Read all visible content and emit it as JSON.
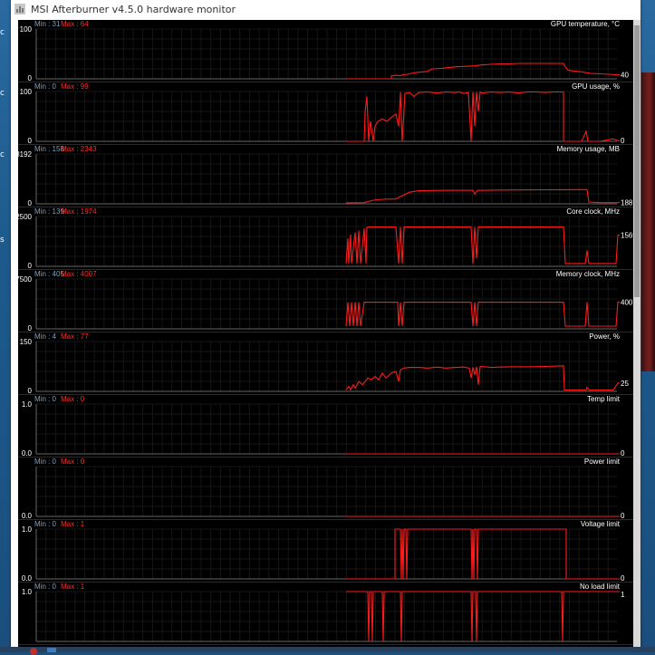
{
  "window": {
    "title": "MSI Afterburner v4.5.0 hardware monitor"
  },
  "desktop_glyphs": [
    "c",
    "c",
    "c",
    "s"
  ],
  "colors": {
    "graph_line": "#ff1a1a",
    "max_label": "#ff2a2a",
    "min_label": "#7aa0c0",
    "text": "#ffffff",
    "grid": "#161616",
    "separator": "#2a2a2a"
  },
  "graphs": [
    {
      "name": "GPU temperature, °C",
      "min_text": "Min : 31",
      "max_text": "Max : 64",
      "y_top_label": "100",
      "y_bottom_label": "0",
      "current_label": "40",
      "ymin": 0,
      "ymax": 100,
      "series": [
        [
          0,
          0
        ],
        [
          50,
          0
        ],
        [
          50,
          6
        ],
        [
          55,
          7
        ],
        [
          60,
          6
        ],
        [
          62,
          8
        ],
        [
          68,
          9
        ],
        [
          72,
          11
        ],
        [
          78,
          13
        ],
        [
          85,
          14
        ],
        [
          90,
          15
        ],
        [
          95,
          20
        ],
        [
          105,
          21
        ],
        [
          110,
          22
        ],
        [
          120,
          24
        ],
        [
          130,
          25
        ],
        [
          142,
          26
        ],
        [
          150,
          28
        ],
        [
          160,
          29
        ],
        [
          170,
          30
        ],
        [
          180,
          30
        ],
        [
          190,
          31
        ],
        [
          200,
          31
        ],
        [
          210,
          31
        ],
        [
          220,
          31
        ],
        [
          230,
          31
        ],
        [
          240,
          31
        ],
        [
          242,
          24
        ],
        [
          245,
          17
        ],
        [
          250,
          16
        ],
        [
          260,
          14
        ],
        [
          270,
          11
        ],
        [
          280,
          10
        ],
        [
          290,
          9
        ],
        [
          300,
          8
        ],
        [
          302,
          8
        ]
      ]
    },
    {
      "name": "GPU usage, %",
      "min_text": "Min : 0",
      "max_text": "Max : 99",
      "y_top_label": "100",
      "y_bottom_label": "0",
      "current_label": "0",
      "ymin": 0,
      "ymax": 100,
      "series": [
        [
          0,
          0
        ],
        [
          20,
          0
        ],
        [
          21,
          60
        ],
        [
          23,
          90
        ],
        [
          25,
          0
        ],
        [
          27,
          40
        ],
        [
          30,
          0
        ],
        [
          32,
          30
        ],
        [
          35,
          40
        ],
        [
          40,
          45
        ],
        [
          45,
          40
        ],
        [
          50,
          48
        ],
        [
          55,
          55
        ],
        [
          58,
          30
        ],
        [
          60,
          99
        ],
        [
          62,
          0
        ],
        [
          65,
          96
        ],
        [
          70,
          98
        ],
        [
          75,
          90
        ],
        [
          80,
          98
        ],
        [
          90,
          99
        ],
        [
          100,
          97
        ],
        [
          110,
          99
        ],
        [
          120,
          98
        ],
        [
          125,
          99
        ],
        [
          130,
          96
        ],
        [
          135,
          98
        ],
        [
          138,
          0
        ],
        [
          140,
          99
        ],
        [
          142,
          30
        ],
        [
          144,
          99
        ],
        [
          146,
          60
        ],
        [
          148,
          99
        ],
        [
          150,
          97
        ],
        [
          160,
          99
        ],
        [
          170,
          98
        ],
        [
          180,
          99
        ],
        [
          190,
          97
        ],
        [
          200,
          99
        ],
        [
          210,
          99
        ],
        [
          220,
          98
        ],
        [
          230,
          99
        ],
        [
          240,
          99
        ],
        [
          240,
          0
        ],
        [
          245,
          0
        ],
        [
          260,
          0
        ],
        [
          265,
          20
        ],
        [
          267,
          0
        ],
        [
          280,
          0
        ],
        [
          295,
          5
        ],
        [
          302,
          0
        ]
      ]
    },
    {
      "name": "Memory usage, MB",
      "min_text": "Min : 158",
      "max_text": "Max : 2343",
      "y_top_label": "8192",
      "y_bottom_label": "0",
      "current_label": "188",
      "ymin": 0,
      "ymax": 8192,
      "series": [
        [
          0,
          158
        ],
        [
          20,
          200
        ],
        [
          30,
          600
        ],
        [
          40,
          750
        ],
        [
          55,
          800
        ],
        [
          58,
          1050
        ],
        [
          70,
          1900
        ],
        [
          80,
          2150
        ],
        [
          100,
          2200
        ],
        [
          120,
          2220
        ],
        [
          140,
          2230
        ],
        [
          142,
          1600
        ],
        [
          145,
          2200
        ],
        [
          160,
          2250
        ],
        [
          180,
          2280
        ],
        [
          200,
          2300
        ],
        [
          220,
          2310
        ],
        [
          240,
          2320
        ],
        [
          266,
          2343
        ],
        [
          268,
          300
        ],
        [
          280,
          188
        ],
        [
          302,
          188
        ]
      ]
    },
    {
      "name": "Core clock, MHz",
      "min_text": "Min : 139",
      "max_text": "Max : 1974",
      "y_top_label": "2500",
      "y_bottom_label": "0",
      "current_label": "1569",
      "ymin": 0,
      "ymax": 2500,
      "series": [
        [
          0,
          139
        ],
        [
          2,
          1400
        ],
        [
          3,
          139
        ],
        [
          5,
          1600
        ],
        [
          6,
          139
        ],
        [
          10,
          1700
        ],
        [
          12,
          139
        ],
        [
          14,
          1800
        ],
        [
          16,
          139
        ],
        [
          20,
          1900
        ],
        [
          22,
          139
        ],
        [
          23,
          1950
        ],
        [
          25,
          1974
        ],
        [
          30,
          1974
        ],
        [
          40,
          1974
        ],
        [
          55,
          1974
        ],
        [
          58,
          139
        ],
        [
          60,
          1974
        ],
        [
          62,
          139
        ],
        [
          64,
          1974
        ],
        [
          100,
          1974
        ],
        [
          130,
          1974
        ],
        [
          138,
          1974
        ],
        [
          140,
          139
        ],
        [
          142,
          1974
        ],
        [
          144,
          400
        ],
        [
          146,
          1974
        ],
        [
          180,
          1974
        ],
        [
          200,
          1974
        ],
        [
          220,
          1974
        ],
        [
          240,
          1974
        ],
        [
          242,
          139
        ],
        [
          260,
          139
        ],
        [
          264,
          139
        ],
        [
          266,
          800
        ],
        [
          268,
          139
        ],
        [
          290,
          139
        ],
        [
          298,
          139
        ],
        [
          300,
          1569
        ],
        [
          302,
          1569
        ]
      ]
    },
    {
      "name": "Memory clock, MHz",
      "min_text": "Min : 405",
      "max_text": "Max : 4007",
      "y_top_label": "7500",
      "y_bottom_label": "0",
      "current_label": "4007",
      "ymin": 0,
      "ymax": 7500,
      "series": [
        [
          0,
          405
        ],
        [
          2,
          4007
        ],
        [
          4,
          405
        ],
        [
          6,
          4007
        ],
        [
          8,
          405
        ],
        [
          10,
          4007
        ],
        [
          12,
          405
        ],
        [
          14,
          4007
        ],
        [
          16,
          405
        ],
        [
          20,
          4007
        ],
        [
          24,
          4007
        ],
        [
          40,
          4007
        ],
        [
          57,
          4007
        ],
        [
          58,
          405
        ],
        [
          60,
          4007
        ],
        [
          62,
          405
        ],
        [
          64,
          4007
        ],
        [
          100,
          4007
        ],
        [
          138,
          4007
        ],
        [
          140,
          405
        ],
        [
          142,
          4007
        ],
        [
          144,
          405
        ],
        [
          146,
          4007
        ],
        [
          200,
          4007
        ],
        [
          240,
          4007
        ],
        [
          242,
          405
        ],
        [
          264,
          405
        ],
        [
          266,
          4007
        ],
        [
          268,
          405
        ],
        [
          298,
          405
        ],
        [
          300,
          4007
        ],
        [
          302,
          4007
        ]
      ]
    },
    {
      "name": "Power, %",
      "min_text": "Min : 4",
      "max_text": "Max : 77",
      "y_top_label": "150",
      "y_bottom_label": "0",
      "current_label": "25",
      "ymin": 0,
      "ymax": 150,
      "series": [
        [
          0,
          4
        ],
        [
          3,
          15
        ],
        [
          5,
          5
        ],
        [
          8,
          20
        ],
        [
          10,
          10
        ],
        [
          14,
          30
        ],
        [
          18,
          20
        ],
        [
          24,
          40
        ],
        [
          28,
          35
        ],
        [
          32,
          45
        ],
        [
          36,
          35
        ],
        [
          40,
          55
        ],
        [
          44,
          40
        ],
        [
          50,
          55
        ],
        [
          55,
          60
        ],
        [
          58,
          30
        ],
        [
          60,
          65
        ],
        [
          64,
          70
        ],
        [
          70,
          72
        ],
        [
          80,
          72
        ],
        [
          90,
          70
        ],
        [
          100,
          73
        ],
        [
          110,
          70
        ],
        [
          120,
          72
        ],
        [
          130,
          73
        ],
        [
          136,
          70
        ],
        [
          138,
          40
        ],
        [
          140,
          72
        ],
        [
          142,
          50
        ],
        [
          144,
          74
        ],
        [
          146,
          20
        ],
        [
          148,
          75
        ],
        [
          160,
          72
        ],
        [
          170,
          73
        ],
        [
          180,
          74
        ],
        [
          200,
          74
        ],
        [
          220,
          75
        ],
        [
          240,
          77
        ],
        [
          241,
          4
        ],
        [
          265,
          4
        ],
        [
          266,
          12
        ],
        [
          268,
          4
        ],
        [
          295,
          4
        ],
        [
          300,
          25
        ],
        [
          302,
          25
        ]
      ]
    },
    {
      "name": "Temp limit",
      "min_text": "Min : 0",
      "max_text": "Max : 0",
      "y_top_label": "1.0",
      "y_bottom_label": "0.0",
      "current_label": "0",
      "ymin": 0,
      "ymax": 1,
      "series": [
        [
          0,
          0
        ],
        [
          302,
          0
        ]
      ]
    },
    {
      "name": "Power limit",
      "min_text": "Min : 0",
      "max_text": "Max : 0",
      "y_top_label": "",
      "y_bottom_label": "0.0",
      "current_label": "0",
      "ymin": 0,
      "ymax": 1,
      "series": [
        [
          0,
          0
        ],
        [
          302,
          0
        ]
      ]
    },
    {
      "name": "Voltage limit",
      "min_text": "Min : 0",
      "max_text": "Max : 1",
      "y_top_label": "1.0",
      "y_bottom_label": "0.0",
      "current_label": "0",
      "ymin": 0,
      "ymax": 1,
      "series": [
        [
          0,
          0
        ],
        [
          54,
          0
        ],
        [
          54,
          1
        ],
        [
          60,
          1
        ],
        [
          61,
          0
        ],
        [
          62,
          1
        ],
        [
          63,
          0
        ],
        [
          64,
          1
        ],
        [
          66,
          1
        ],
        [
          67,
          0
        ],
        [
          68,
          1
        ],
        [
          138,
          1
        ],
        [
          139,
          0
        ],
        [
          140,
          1
        ],
        [
          141,
          0
        ],
        [
          142,
          1
        ],
        [
          144,
          1
        ],
        [
          145,
          0
        ],
        [
          146,
          1
        ],
        [
          243,
          1
        ],
        [
          243,
          0
        ],
        [
          302,
          0
        ]
      ]
    },
    {
      "name": "No load limit",
      "min_text": "Min : 0",
      "max_text": "Max : 1",
      "y_top_label": "1.0",
      "y_bottom_label": "",
      "current_label": "1",
      "ymin": 0,
      "ymax": 1,
      "series": [
        [
          0,
          1
        ],
        [
          24,
          1
        ],
        [
          25,
          0
        ],
        [
          26,
          1
        ],
        [
          28,
          1
        ],
        [
          29,
          0
        ],
        [
          30,
          1
        ],
        [
          40,
          1
        ],
        [
          41,
          0
        ],
        [
          42,
          1
        ],
        [
          60,
          1
        ],
        [
          61,
          0
        ],
        [
          62,
          1
        ],
        [
          138,
          1
        ],
        [
          139,
          0
        ],
        [
          140,
          1
        ],
        [
          143,
          1
        ],
        [
          144,
          0
        ],
        [
          145,
          1
        ],
        [
          200,
          1
        ],
        [
          238,
          1
        ],
        [
          239,
          0
        ],
        [
          240,
          1
        ],
        [
          302,
          1
        ]
      ]
    }
  ]
}
